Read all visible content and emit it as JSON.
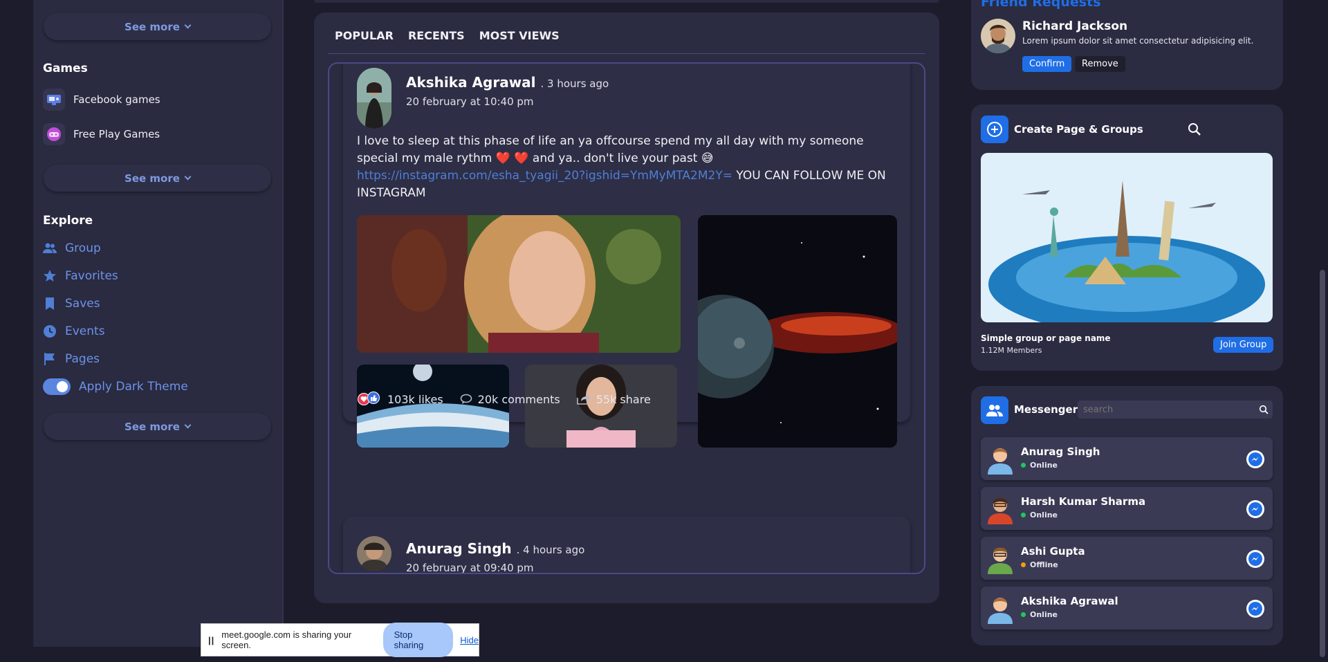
{
  "left_sidebar": {
    "see_more_1": "See more",
    "games_title": "Games",
    "games": [
      {
        "label": "Facebook games",
        "icon": "game-console-icon"
      },
      {
        "label": "Free Play Games",
        "icon": "gamepad-icon"
      }
    ],
    "see_more_2": "See more",
    "explore_title": "Explore",
    "explore": [
      {
        "label": "Group",
        "icon": "group-icon"
      },
      {
        "label": "Favorites",
        "icon": "star-icon"
      },
      {
        "label": "Saves",
        "icon": "bookmark-icon"
      },
      {
        "label": "Events",
        "icon": "clock-icon"
      },
      {
        "label": "Pages",
        "icon": "flag-icon"
      }
    ],
    "dark_theme_label": "Apply Dark Theme",
    "dark_theme_on": true,
    "see_more_3": "See more"
  },
  "feed": {
    "tabs": [
      "POPULAR",
      "RECENTS",
      "MOST VIEWS"
    ],
    "posts": [
      {
        "author": "Akshika Agrawal",
        "time_ago": ". 3 hours ago",
        "date": "20 february at 10:40 pm",
        "text_before": "I love to sleep at this phase of life an ya offcourse spend my all day with my someone special my male rythm ❤️ ❤️ and ya.. don't live your past 😅",
        "link": "https://instagram.com/esha_tyagii_20?igshid=YmMyMTA2M2Y=",
        "text_after": " YOU CAN FOLLOW ME ON INSTAGRAM",
        "likes": "103k likes",
        "comments": "20k comments",
        "shares": "55k share"
      },
      {
        "author": "Anurag Singh",
        "time_ago": ". 4 hours ago",
        "date": "20 february at 09:40 pm"
      }
    ]
  },
  "right_sidebar": {
    "friend_requests_title": "Friend Requests",
    "request": {
      "name": "Richard Jackson",
      "text": "Lorem ipsum dolor sit amet consectetur adipisicing elit.",
      "confirm": "Confirm",
      "remove": "Remove"
    },
    "create_title": "Create Page & Groups",
    "group_name": "Simple group or page name",
    "group_members": "1.12M Members",
    "join_label": "Join Group",
    "messenger_title": "Messenger",
    "search_placeholder": "search",
    "contacts": [
      {
        "name": "Anurag Singh",
        "status": "Online",
        "status_color": "#22c55e"
      },
      {
        "name": "Harsh Kumar Sharma",
        "status": "Online",
        "status_color": "#22c55e"
      },
      {
        "name": "Ashi Gupta",
        "status": "Offline",
        "status_color": "#f59e0b"
      },
      {
        "name": "Akshika Agrawal",
        "status": "Online",
        "status_color": "#22c55e"
      }
    ]
  },
  "share_bar": {
    "message": "meet.google.com is sharing your screen.",
    "stop": "Stop sharing",
    "hide": "Hide"
  },
  "colors": {
    "accent": "#1f6ee6",
    "link": "#4f7fd6",
    "card": "#2b2b42"
  }
}
